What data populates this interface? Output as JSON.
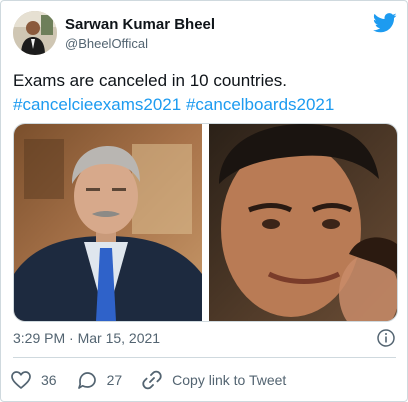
{
  "tweet": {
    "author_name": "Sarwan Kumar Bheel",
    "author_handle": "@BheelOffical",
    "text": "Exams are canceled in 10 countries.",
    "hashtags": [
      "#cancelcieexams2021",
      "#cancelboards2021"
    ],
    "timestamp": "3:29 PM · Mar 15, 2021",
    "likes": "36",
    "replies": "27",
    "copy_link_label": "Copy link to Tweet"
  },
  "icons": {
    "brand": "twitter-bird-icon",
    "info": "info-icon",
    "like": "heart-icon",
    "reply": "comment-icon",
    "copy": "link-icon"
  },
  "colors": {
    "accent": "#1d9bf0",
    "text": "#0f1419",
    "secondary": "#536471",
    "border": "#cfd9de"
  }
}
